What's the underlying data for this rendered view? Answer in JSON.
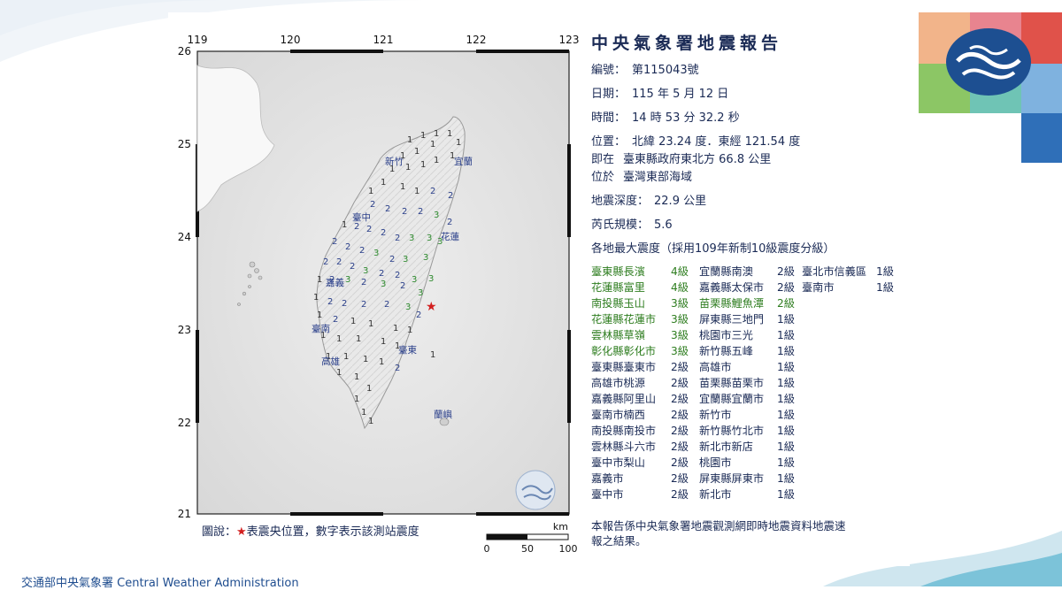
{
  "report": {
    "title": "中央氣象署地震報告",
    "no_label": "編號：",
    "no": "第115043號",
    "date_label": "日期：",
    "date": "115 年 5 月 12 日",
    "time_label": "時間：",
    "time": "14 時 53 分 32.2 秒",
    "loc_label": "位置：",
    "loc": "北緯 23.24 度．東經 121.54 度",
    "at_label": "即在",
    "at": "臺東縣政府東北方 66.8 公里",
    "in_label": "位於",
    "in": "臺灣東部海域",
    "depth_label": "地震深度：",
    "depth": "22.9 公里",
    "mag_label": "芮氏規模：",
    "mag": "5.6",
    "intensity_header": "各地最大震度（採用109年新制10級震度分級）"
  },
  "intensity": [
    [
      {
        "n": "臺東縣長濱",
        "l": "4級",
        "g": true
      },
      {
        "n": "宜蘭縣南澳",
        "l": "2級"
      },
      {
        "n": "臺北市信義區",
        "l": "1級"
      }
    ],
    [
      {
        "n": "花蓮縣富里",
        "l": "4級",
        "g": true
      },
      {
        "n": "嘉義縣太保市",
        "l": "2級"
      },
      {
        "n": "臺南市",
        "l": "1級"
      }
    ],
    [
      {
        "n": "南投縣玉山",
        "l": "3級",
        "g": true
      },
      {
        "n": "苗栗縣鯉魚潭",
        "l": "2級",
        "g": true
      }
    ],
    [
      {
        "n": "花蓮縣花蓮市",
        "l": "3級",
        "g": true
      },
      {
        "n": "屏東縣三地門",
        "l": "1級"
      }
    ],
    [
      {
        "n": "雲林縣草嶺",
        "l": "3級",
        "g": true
      },
      {
        "n": "桃園市三光",
        "l": "1級"
      }
    ],
    [
      {
        "n": "彰化縣彰化市",
        "l": "3級",
        "g": true
      },
      {
        "n": "新竹縣五峰",
        "l": "1級"
      }
    ],
    [
      {
        "n": "臺東縣臺東市",
        "l": "2級"
      },
      {
        "n": "高雄市",
        "l": "1級"
      }
    ],
    [
      {
        "n": "高雄市桃源",
        "l": "2級"
      },
      {
        "n": "苗栗縣苗栗市",
        "l": "1級"
      }
    ],
    [
      {
        "n": "嘉義縣阿里山",
        "l": "2級"
      },
      {
        "n": "宜蘭縣宜蘭市",
        "l": "1級"
      }
    ],
    [
      {
        "n": "臺南市楠西",
        "l": "2級"
      },
      {
        "n": "新竹市",
        "l": "1級"
      }
    ],
    [
      {
        "n": "南投縣南投市",
        "l": "2級"
      },
      {
        "n": "新竹縣竹北市",
        "l": "1級"
      }
    ],
    [
      {
        "n": "雲林縣斗六市",
        "l": "2級"
      },
      {
        "n": "新北市新店",
        "l": "1級"
      }
    ],
    [
      {
        "n": "臺中市梨山",
        "l": "2級"
      },
      {
        "n": "桃園市",
        "l": "1級"
      }
    ],
    [
      {
        "n": "嘉義市",
        "l": "2級"
      },
      {
        "n": "屏東縣屏東市",
        "l": "1級"
      }
    ],
    [
      {
        "n": "臺中市",
        "l": "2級"
      },
      {
        "n": "新北市",
        "l": "1級"
      }
    ]
  ],
  "map": {
    "lon_ticks": [
      "119",
      "120",
      "121",
      "122",
      "123"
    ],
    "lat_ticks": [
      "26",
      "25",
      "24",
      "23",
      "22",
      "21"
    ],
    "cities": [
      "新竹",
      "宜蘭",
      "臺中",
      "花蓮",
      "嘉義",
      "臺南",
      "臺東",
      "高雄",
      "蘭嶼"
    ],
    "scale_unit": "km",
    "scale_labels": [
      "0",
      "50",
      "100"
    ]
  },
  "legend": {
    "prefix": "圖說：",
    "star": "★",
    "text": "表震央位置，數字表示該測站震度"
  },
  "note": "本報告係中央氣象署地震觀測網即時地震資料地震速報之結果。",
  "footer": "交通部中央氣象署 Central Weather Administration",
  "colors": {
    "navy": "#1a2a55",
    "green": "#2e7d1f",
    "star": "#d21f1f",
    "blue": "#2f6fb8"
  }
}
